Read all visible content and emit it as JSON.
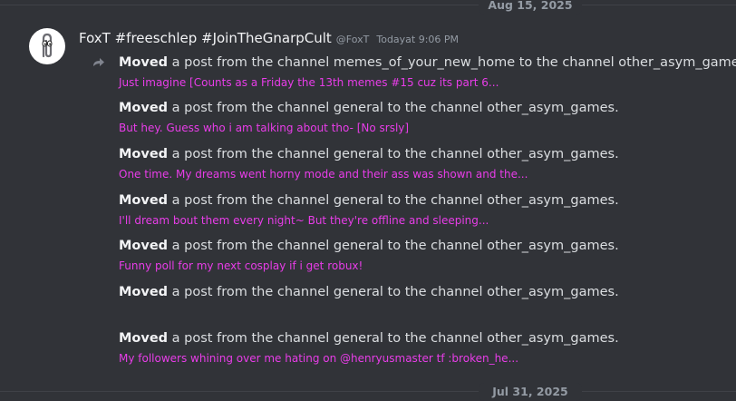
{
  "date_separators": {
    "top": "Aug 15, 2025",
    "bottom": "Jul 31, 2025"
  },
  "message": {
    "username": "FoxT #freeschlep #JoinTheGnarpCult",
    "handle": "@FoxT",
    "timestamp": "Todayat 9:06 PM",
    "avatar_icon": "paperclip-icon",
    "reply_icon": "forward-arrow-icon"
  },
  "entries": [
    {
      "verb": "Moved",
      "text": "a post from the channel memes_of_your_new_home to the channel other_asym_games.",
      "preview": "Just imagine [Counts as a Friday the 13th memes #15 cuz its part 6..."
    },
    {
      "verb": "Moved",
      "text": "a post from the channel general to the channel other_asym_games.",
      "preview": "But hey. Guess who i am talking about tho- [No srsly]"
    },
    {
      "verb": "Moved",
      "text": "a post from the channel general to the channel other_asym_games.",
      "preview": "One time. My dreams went horny mode and their ass was shown and the..."
    },
    {
      "verb": "Moved",
      "text": "a post from the channel general to the channel other_asym_games.",
      "preview": "I'll dream bout them every night~ But they're offline and sleeping..."
    },
    {
      "verb": "Moved",
      "text": "a post from the channel general to the channel other_asym_games.",
      "preview": "Funny poll for my next cosplay if i get robux!"
    },
    {
      "verb": "Moved",
      "text": "a post from the channel general to the channel other_asym_games.",
      "preview": ""
    },
    {
      "verb": "Moved",
      "text": "a post from the channel general to the channel other_asym_games.",
      "preview": "My followers whining over me hating on @henryusmaster tf :broken_he..."
    }
  ],
  "colors": {
    "background": "#313338",
    "preview_link": "#e83de8",
    "muted": "#949ba4"
  }
}
